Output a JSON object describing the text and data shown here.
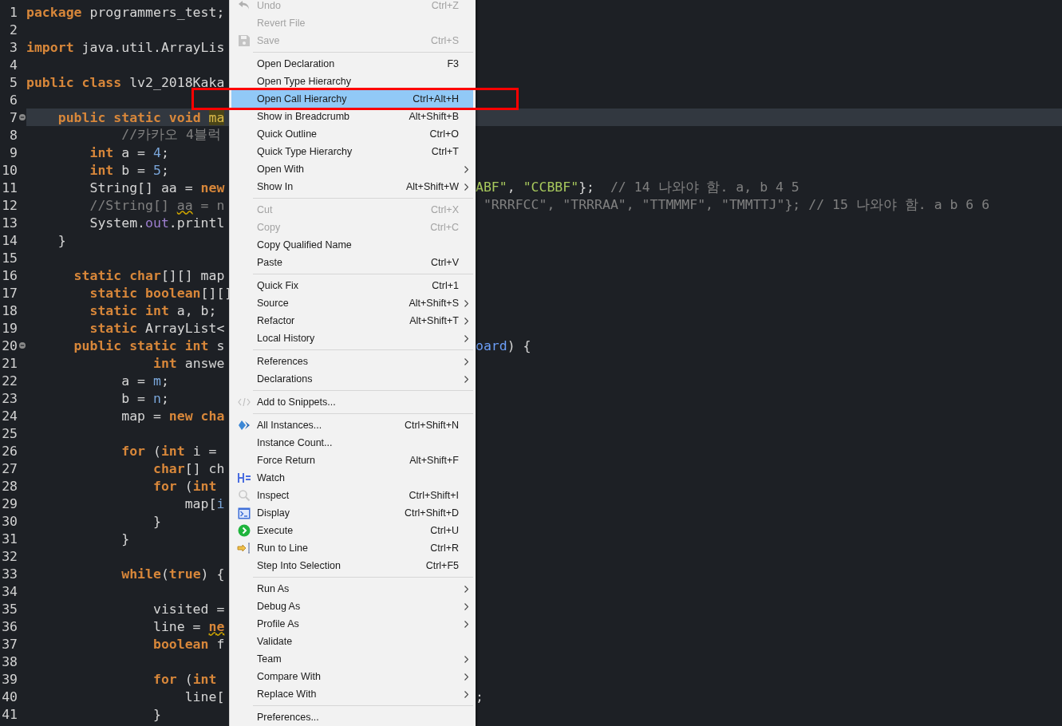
{
  "editor": {
    "lines": [
      {
        "number": "1",
        "fold": false,
        "current": false,
        "left": [
          {
            "kind": "keyword",
            "text": "package"
          },
          {
            "kind": "plain",
            "text": " programmers_test;"
          }
        ]
      },
      {
        "number": "2",
        "fold": false,
        "current": false
      },
      {
        "number": "3",
        "fold": false,
        "current": false,
        "left": [
          {
            "kind": "keyword",
            "text": "import"
          },
          {
            "kind": "plain",
            "text": " java.util.ArrayLis"
          }
        ]
      },
      {
        "number": "4",
        "fold": false,
        "current": false
      },
      {
        "number": "5",
        "fold": false,
        "current": false,
        "left": [
          {
            "kind": "keyword",
            "text": "public class"
          },
          {
            "kind": "plain",
            "text": " lv2_2018Kaka"
          }
        ]
      },
      {
        "number": "6",
        "fold": false,
        "current": false
      },
      {
        "number": "7",
        "fold": true,
        "current": true,
        "left": [
          {
            "kind": "keyword",
            "text": "    public static void "
          },
          {
            "kind": "occurrence",
            "text": "ma"
          }
        ]
      },
      {
        "number": "8",
        "fold": false,
        "current": false,
        "left": [
          {
            "kind": "comment",
            "text": "            //카카오 4블럭"
          }
        ]
      },
      {
        "number": "9",
        "fold": false,
        "current": false,
        "left": [
          {
            "kind": "keyword",
            "text": "        int"
          },
          {
            "kind": "plain",
            "text": " a = "
          },
          {
            "kind": "number",
            "text": "4"
          },
          {
            "kind": "plain",
            "text": ";"
          }
        ]
      },
      {
        "number": "10",
        "fold": false,
        "current": false,
        "left": [
          {
            "kind": "keyword",
            "text": "        int"
          },
          {
            "kind": "plain",
            "text": " b = "
          },
          {
            "kind": "number",
            "text": "5"
          },
          {
            "kind": "plain",
            "text": ";"
          }
        ]
      },
      {
        "number": "11",
        "fold": false,
        "current": false,
        "left": [
          {
            "kind": "plain",
            "text": "        String[] aa = "
          },
          {
            "kind": "keyword",
            "text": "new"
          }
        ],
        "right": [
          {
            "kind": "string",
            "text": "ABF\""
          },
          {
            "kind": "plain",
            "text": ", "
          },
          {
            "kind": "string",
            "text": "\"CCBBF\""
          },
          {
            "kind": "plain",
            "text": "};  "
          },
          {
            "kind": "comment",
            "text": "// 14 나와야 함. a, b 4 5"
          }
        ]
      },
      {
        "number": "12",
        "fold": false,
        "current": false,
        "left": [
          {
            "kind": "comment",
            "text": "        //String[] "
          },
          {
            "kind": "warning",
            "text": "aa"
          },
          {
            "kind": "comment",
            "text": " = n"
          }
        ],
        "right": [
          {
            "kind": "comment",
            "text": " \"RRRFCC\", \"TRRRAA\", \"TTMMMF\", \"TMMTTJ\"}; // 15 나와야 함. a b 6 6"
          }
        ]
      },
      {
        "number": "13",
        "fold": false,
        "current": false,
        "left": [
          {
            "kind": "plain",
            "text": "        System."
          },
          {
            "kind": "static",
            "text": "out"
          },
          {
            "kind": "plain",
            "text": ".printl"
          }
        ]
      },
      {
        "number": "14",
        "fold": false,
        "current": false,
        "left": [
          {
            "kind": "plain",
            "text": "    }"
          }
        ]
      },
      {
        "number": "15",
        "fold": false,
        "current": false
      },
      {
        "number": "16",
        "fold": false,
        "current": false,
        "left": [
          {
            "kind": "keyword",
            "text": "      static char"
          },
          {
            "kind": "plain",
            "text": "[][] map"
          }
        ]
      },
      {
        "number": "17",
        "fold": false,
        "current": false,
        "left": [
          {
            "kind": "keyword",
            "text": "        static boolean"
          },
          {
            "kind": "plain",
            "text": "[][]"
          }
        ]
      },
      {
        "number": "18",
        "fold": false,
        "current": false,
        "left": [
          {
            "kind": "keyword",
            "text": "        static int"
          },
          {
            "kind": "plain",
            "text": " a, b;"
          }
        ]
      },
      {
        "number": "19",
        "fold": false,
        "current": false,
        "left": [
          {
            "kind": "keyword",
            "text": "        static"
          },
          {
            "kind": "plain",
            "text": " ArrayList<"
          }
        ]
      },
      {
        "number": "20",
        "fold": true,
        "current": false,
        "left": [
          {
            "kind": "keyword",
            "text": "      public static int"
          },
          {
            "kind": "plain",
            "text": " s"
          }
        ],
        "right": [
          {
            "kind": "param",
            "text": "oard"
          },
          {
            "kind": "plain",
            "text": ") {"
          }
        ]
      },
      {
        "number": "21",
        "fold": false,
        "current": false,
        "left": [
          {
            "kind": "keyword",
            "text": "                int"
          },
          {
            "kind": "plain",
            "text": " answe"
          }
        ]
      },
      {
        "number": "22",
        "fold": false,
        "current": false,
        "left": [
          {
            "kind": "plain",
            "text": "            a = "
          },
          {
            "kind": "field",
            "text": "m"
          },
          {
            "kind": "plain",
            "text": ";"
          }
        ]
      },
      {
        "number": "23",
        "fold": false,
        "current": false,
        "left": [
          {
            "kind": "plain",
            "text": "            b = "
          },
          {
            "kind": "field",
            "text": "n"
          },
          {
            "kind": "plain",
            "text": ";"
          }
        ]
      },
      {
        "number": "24",
        "fold": false,
        "current": false,
        "left": [
          {
            "kind": "plain",
            "text": "            map = "
          },
          {
            "kind": "keyword",
            "text": "new cha"
          }
        ]
      },
      {
        "number": "25",
        "fold": false,
        "current": false
      },
      {
        "number": "26",
        "fold": false,
        "current": false,
        "left": [
          {
            "kind": "keyword",
            "text": "            for"
          },
          {
            "kind": "plain",
            "text": " ("
          },
          {
            "kind": "keyword",
            "text": "int"
          },
          {
            "kind": "plain",
            "text": " i ="
          }
        ]
      },
      {
        "number": "27",
        "fold": false,
        "current": false,
        "left": [
          {
            "kind": "keyword",
            "text": "                char"
          },
          {
            "kind": "plain",
            "text": "[] ch"
          }
        ]
      },
      {
        "number": "28",
        "fold": false,
        "current": false,
        "left": [
          {
            "kind": "keyword",
            "text": "                for"
          },
          {
            "kind": "plain",
            "text": " ("
          },
          {
            "kind": "keyword",
            "text": "int"
          }
        ]
      },
      {
        "number": "29",
        "fold": false,
        "current": false,
        "left": [
          {
            "kind": "plain",
            "text": "                    map["
          },
          {
            "kind": "field",
            "text": "i"
          }
        ]
      },
      {
        "number": "30",
        "fold": false,
        "current": false,
        "left": [
          {
            "kind": "plain",
            "text": "                }"
          }
        ]
      },
      {
        "number": "31",
        "fold": false,
        "current": false,
        "left": [
          {
            "kind": "plain",
            "text": "            }"
          }
        ]
      },
      {
        "number": "32",
        "fold": false,
        "current": false
      },
      {
        "number": "33",
        "fold": false,
        "current": false,
        "left": [
          {
            "kind": "keyword",
            "text": "            while"
          },
          {
            "kind": "plain",
            "text": "("
          },
          {
            "kind": "keyword",
            "text": "true"
          },
          {
            "kind": "plain",
            "text": ") {"
          }
        ]
      },
      {
        "number": "34",
        "fold": false,
        "current": false
      },
      {
        "number": "35",
        "fold": false,
        "current": false,
        "left": [
          {
            "kind": "plain",
            "text": "                visited ="
          }
        ]
      },
      {
        "number": "36",
        "fold": false,
        "current": false,
        "left": [
          {
            "kind": "plain",
            "text": "                line = "
          },
          {
            "kind": "warning-keyword",
            "text": "ne"
          }
        ]
      },
      {
        "number": "37",
        "fold": false,
        "current": false,
        "left": [
          {
            "kind": "keyword",
            "text": "                boolean"
          },
          {
            "kind": "plain",
            "text": " f"
          }
        ]
      },
      {
        "number": "38",
        "fold": false,
        "current": false
      },
      {
        "number": "39",
        "fold": false,
        "current": false,
        "left": [
          {
            "kind": "keyword",
            "text": "                for"
          },
          {
            "kind": "plain",
            "text": " ("
          },
          {
            "kind": "keyword",
            "text": "int"
          }
        ]
      },
      {
        "number": "40",
        "fold": false,
        "current": false,
        "left": [
          {
            "kind": "plain",
            "text": "                    line["
          }
        ],
        "right": [
          {
            "kind": "plain",
            "text": ";"
          }
        ]
      },
      {
        "number": "41",
        "fold": false,
        "current": false,
        "left": [
          {
            "kind": "plain",
            "text": "                }"
          }
        ]
      }
    ]
  },
  "context_menu": {
    "groups": [
      {
        "items": [
          {
            "kind": "undo",
            "label": "Undo",
            "shortcut": "Ctrl+Z",
            "disabled": true,
            "selected": false,
            "submenu": false
          },
          {
            "kind": "text",
            "label": "Revert File",
            "disabled": true,
            "selected": false,
            "submenu": false
          },
          {
            "kind": "save",
            "label": "Save",
            "shortcut": "Ctrl+S",
            "disabled": true,
            "selected": false,
            "submenu": false
          }
        ]
      },
      {
        "items": [
          {
            "kind": "text",
            "label": "Open Declaration",
            "shortcut": "F3",
            "disabled": false,
            "selected": false,
            "submenu": false
          },
          {
            "kind": "text",
            "label": "Open Type Hierarchy",
            "disabled": false,
            "selected": false,
            "submenu": false
          },
          {
            "kind": "text",
            "label": "Open Call Hierarchy",
            "shortcut": "Ctrl+Alt+H",
            "disabled": false,
            "selected": true,
            "submenu": false
          },
          {
            "kind": "text",
            "label": "Show in Breadcrumb",
            "shortcut": "Alt+Shift+B",
            "disabled": false,
            "selected": false,
            "submenu": false
          },
          {
            "kind": "text",
            "label": "Quick Outline",
            "shortcut": "Ctrl+O",
            "disabled": false,
            "selected": false,
            "submenu": false
          },
          {
            "kind": "text",
            "label": "Quick Type Hierarchy",
            "shortcut": "Ctrl+T",
            "disabled": false,
            "selected": false,
            "submenu": false
          },
          {
            "kind": "text",
            "label": "Open With",
            "disabled": false,
            "selected": false,
            "submenu": true
          },
          {
            "kind": "text",
            "label": "Show In",
            "shortcut": "Alt+Shift+W",
            "disabled": false,
            "selected": false,
            "submenu": true
          }
        ]
      },
      {
        "items": [
          {
            "kind": "text",
            "label": "Cut",
            "shortcut": "Ctrl+X",
            "disabled": true,
            "selected": false,
            "submenu": false
          },
          {
            "kind": "text",
            "label": "Copy",
            "shortcut": "Ctrl+C",
            "disabled": true,
            "selected": false,
            "submenu": false
          },
          {
            "kind": "text",
            "label": "Copy Qualified Name",
            "disabled": false,
            "selected": false,
            "submenu": false
          },
          {
            "kind": "text",
            "label": "Paste",
            "shortcut": "Ctrl+V",
            "disabled": false,
            "selected": false,
            "submenu": false
          }
        ]
      },
      {
        "items": [
          {
            "kind": "text",
            "label": "Quick Fix",
            "shortcut": "Ctrl+1",
            "disabled": false,
            "selected": false,
            "submenu": false
          },
          {
            "kind": "text",
            "label": "Source",
            "shortcut": "Alt+Shift+S",
            "disabled": false,
            "selected": false,
            "submenu": true
          },
          {
            "kind": "text",
            "label": "Refactor",
            "shortcut": "Alt+Shift+T",
            "disabled": false,
            "selected": false,
            "submenu": true
          },
          {
            "kind": "text",
            "label": "Local History",
            "disabled": false,
            "selected": false,
            "submenu": true
          }
        ]
      },
      {
        "items": [
          {
            "kind": "text",
            "label": "References",
            "disabled": false,
            "selected": false,
            "submenu": true
          },
          {
            "kind": "text",
            "label": "Declarations",
            "disabled": false,
            "selected": false,
            "submenu": true
          }
        ]
      },
      {
        "items": [
          {
            "kind": "snippet",
            "label": "Add to Snippets...",
            "disabled": false,
            "selected": false,
            "submenu": false
          }
        ]
      },
      {
        "items": [
          {
            "kind": "instances",
            "label": "All Instances...",
            "shortcut": "Ctrl+Shift+N",
            "disabled": false,
            "selected": false,
            "submenu": false
          },
          {
            "kind": "text",
            "label": "Instance Count...",
            "disabled": false,
            "selected": false,
            "submenu": false
          },
          {
            "kind": "text",
            "label": "Force Return",
            "shortcut": "Alt+Shift+F",
            "disabled": false,
            "selected": false,
            "submenu": false
          },
          {
            "kind": "watch",
            "label": "Watch",
            "disabled": false,
            "selected": false,
            "submenu": false
          },
          {
            "kind": "inspect",
            "label": "Inspect",
            "shortcut": "Ctrl+Shift+I",
            "disabled": false,
            "selected": false,
            "submenu": false
          },
          {
            "kind": "display",
            "label": "Display",
            "shortcut": "Ctrl+Shift+D",
            "disabled": false,
            "selected": false,
            "submenu": false
          },
          {
            "kind": "execute",
            "label": "Execute",
            "shortcut": "Ctrl+U",
            "disabled": false,
            "selected": false,
            "submenu": false
          },
          {
            "kind": "runtoline",
            "label": "Run to Line",
            "shortcut": "Ctrl+R",
            "disabled": false,
            "selected": false,
            "submenu": false
          },
          {
            "kind": "text",
            "label": "Step Into Selection",
            "shortcut": "Ctrl+F5",
            "disabled": false,
            "selected": false,
            "submenu": false
          }
        ]
      },
      {
        "items": [
          {
            "kind": "text",
            "label": "Run As",
            "disabled": false,
            "selected": false,
            "submenu": true
          },
          {
            "kind": "text",
            "label": "Debug As",
            "disabled": false,
            "selected": false,
            "submenu": true
          },
          {
            "kind": "text",
            "label": "Profile As",
            "disabled": false,
            "selected": false,
            "submenu": true
          },
          {
            "kind": "text",
            "label": "Validate",
            "disabled": false,
            "selected": false,
            "submenu": false
          },
          {
            "kind": "text",
            "label": "Team",
            "disabled": false,
            "selected": false,
            "submenu": true
          },
          {
            "kind": "text",
            "label": "Compare With",
            "disabled": false,
            "selected": false,
            "submenu": true
          },
          {
            "kind": "text",
            "label": "Replace With",
            "disabled": false,
            "selected": false,
            "submenu": true
          }
        ]
      },
      {
        "items": [
          {
            "kind": "text",
            "label": "Preferences...",
            "disabled": false,
            "selected": false,
            "submenu": false
          }
        ]
      }
    ]
  }
}
